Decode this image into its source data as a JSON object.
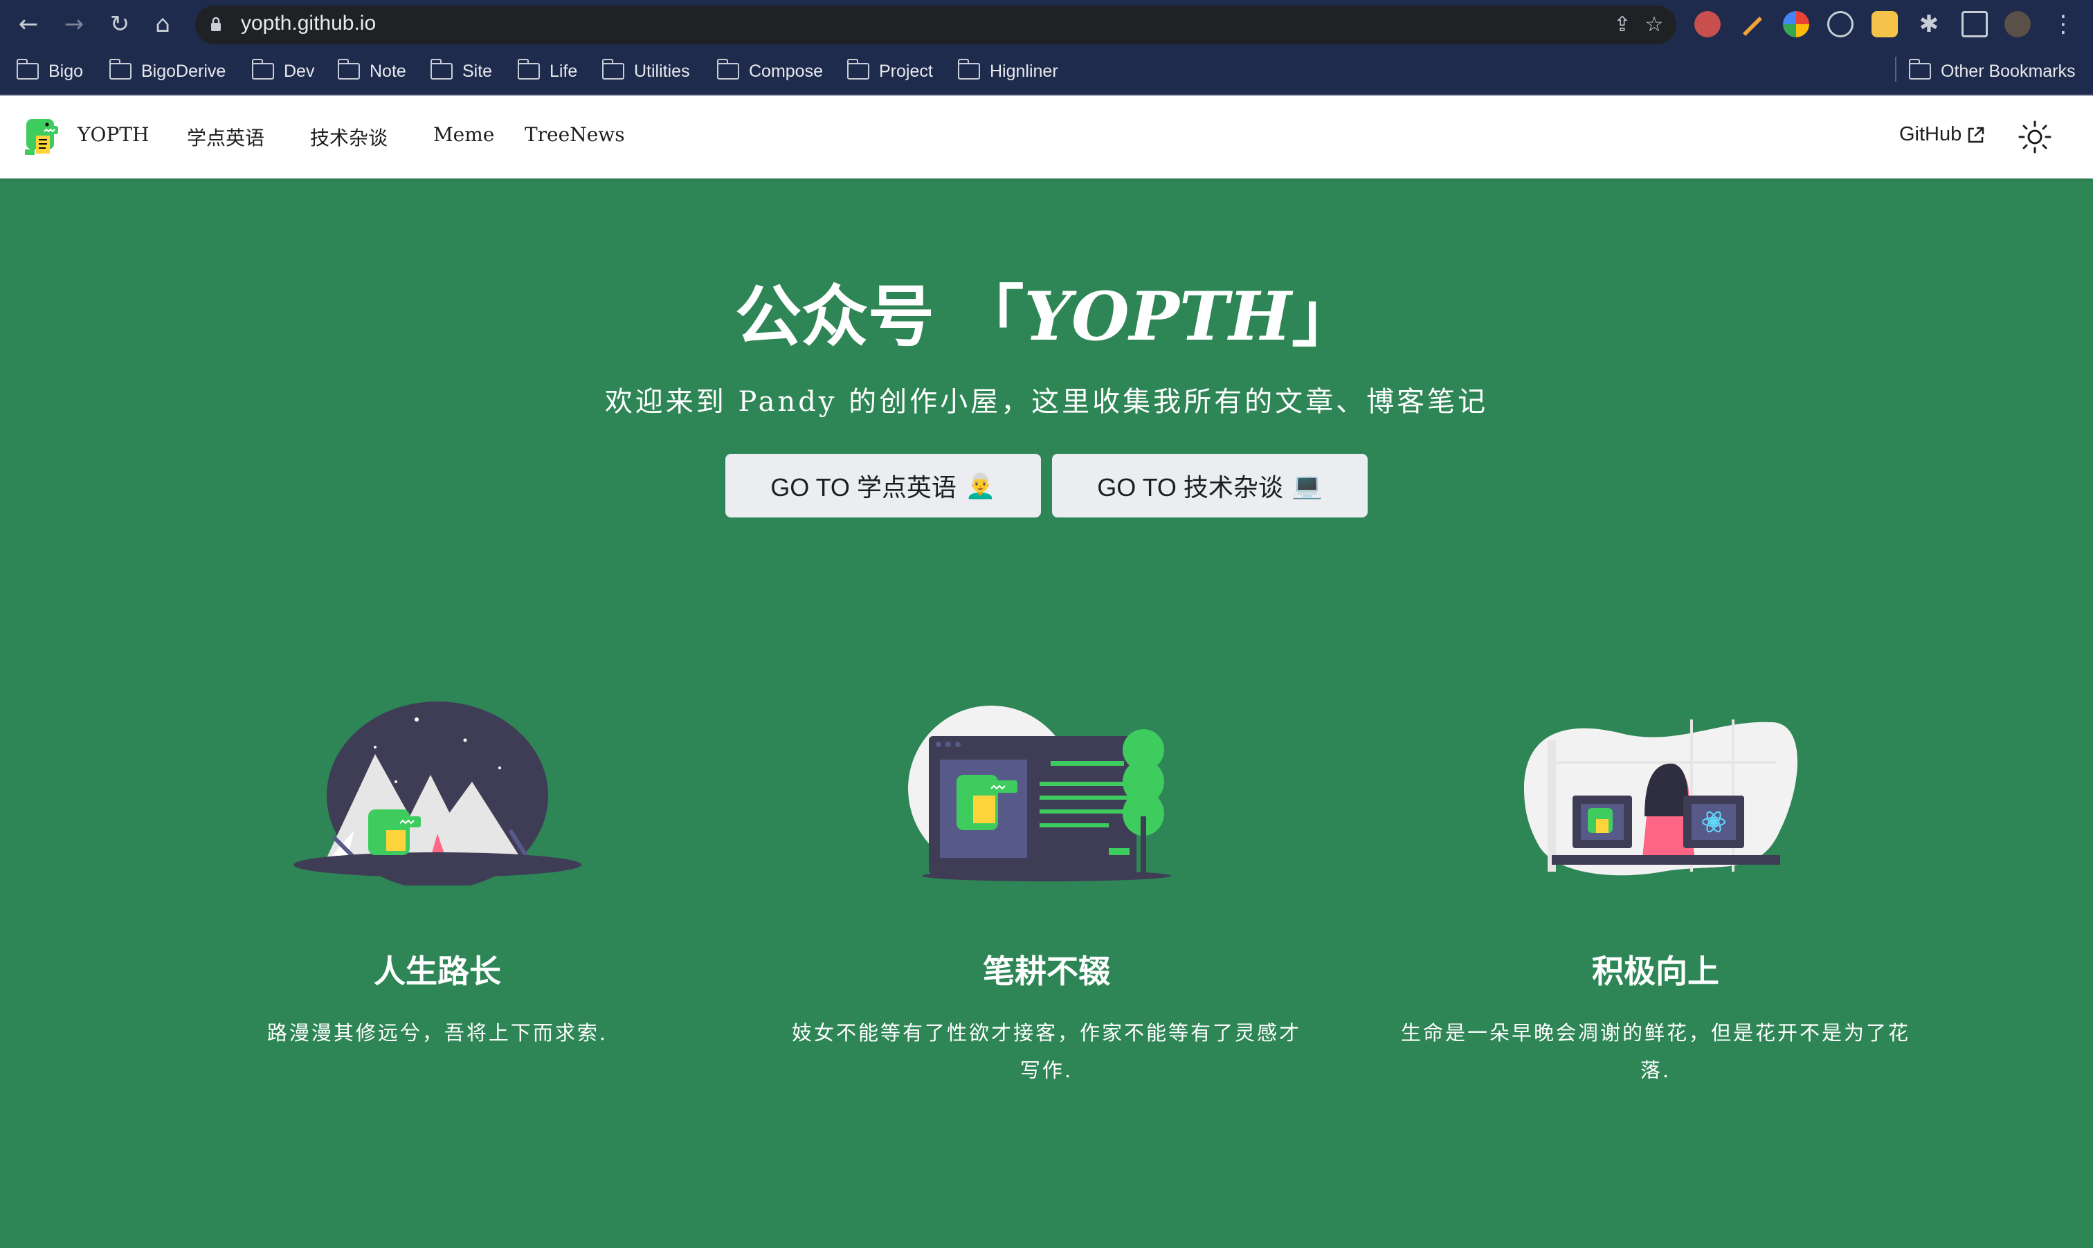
{
  "browser": {
    "url": "yopth.github.io",
    "bookmarks": [
      "Bigo",
      "BigoDerive",
      "Dev",
      "Note",
      "Site",
      "Life",
      "Utilities",
      "Compose",
      "Project",
      "Hignliner"
    ],
    "other_bookmarks": "Other Bookmarks"
  },
  "navbar": {
    "brand": "YOPTH",
    "links": [
      "学点英语",
      "技术杂谈",
      "Meme",
      "TreeNews"
    ],
    "github": "GitHub"
  },
  "hero": {
    "title_prefix": "公众号 「",
    "title_brand": "YOPTH",
    "title_suffix": "」",
    "subtitle": "欢迎来到 Pandy 的创作小屋，这里收集我所有的文章、博客笔记",
    "buttons": [
      "GO TO 学点英语",
      "GO TO 技术杂谈"
    ],
    "button_emojis": [
      "👨‍🦳",
      "💻"
    ]
  },
  "features": [
    {
      "title": "人生路长",
      "description": "路漫漫其修远兮，吾将上下而求索."
    },
    {
      "title": "笔耕不辍",
      "description": "妓女不能等有了性欲才接客，作家不能等有了灵感才写作."
    },
    {
      "title": "积极向上",
      "description": "生命是一朵早晚会凋谢的鲜花，但是花开不是为了花落."
    }
  ],
  "colors": {
    "primary": "#2e8555",
    "mascot": "#3ecc5f",
    "chrome": "#1f2b4d"
  }
}
